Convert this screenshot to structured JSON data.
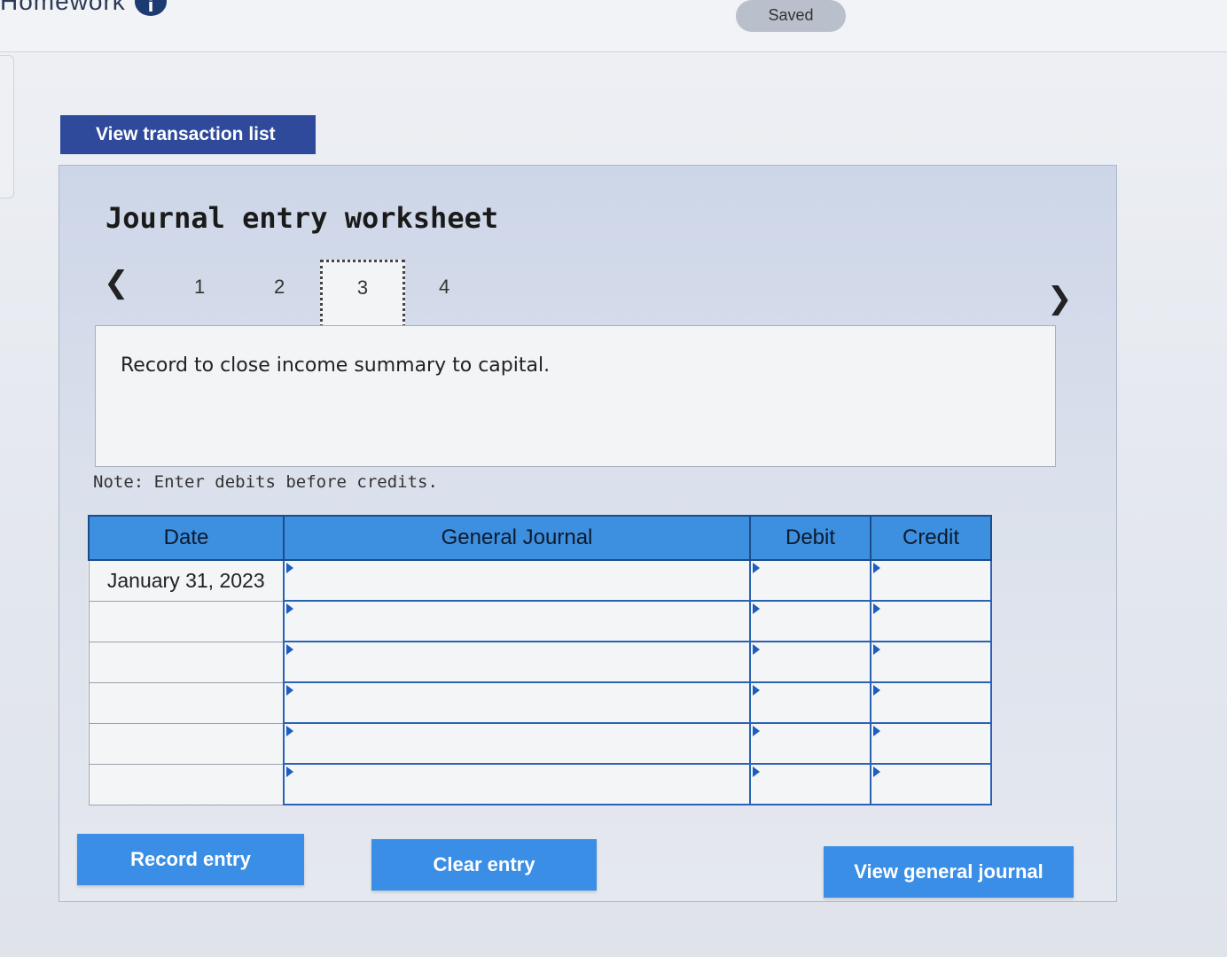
{
  "header": {
    "title": "Homework",
    "saved_label": "Saved"
  },
  "toolbar": {
    "view_transaction_list_label": "View transaction list"
  },
  "worksheet": {
    "title": "Journal entry worksheet",
    "steps": [
      "1",
      "2",
      "3",
      "4"
    ],
    "active_step": "3",
    "prompt": "Record to close income summary to capital.",
    "note": "Note: Enter debits before credits."
  },
  "journal": {
    "headers": {
      "date": "Date",
      "general_journal": "General Journal",
      "debit": "Debit",
      "credit": "Credit"
    },
    "rows": [
      {
        "date": "January 31, 2023",
        "account": "",
        "debit": "",
        "credit": ""
      },
      {
        "date": "",
        "account": "",
        "debit": "",
        "credit": ""
      },
      {
        "date": "",
        "account": "",
        "debit": "",
        "credit": ""
      },
      {
        "date": "",
        "account": "",
        "debit": "",
        "credit": ""
      },
      {
        "date": "",
        "account": "",
        "debit": "",
        "credit": ""
      },
      {
        "date": "",
        "account": "",
        "debit": "",
        "credit": ""
      }
    ]
  },
  "actions": {
    "record_entry": "Record entry",
    "clear_entry": "Clear entry",
    "view_general_journal": "View general journal"
  },
  "colors": {
    "primary_dark": "#2f4a9a",
    "primary_button": "#3a8ee6",
    "table_header": "#3d8fe0"
  }
}
